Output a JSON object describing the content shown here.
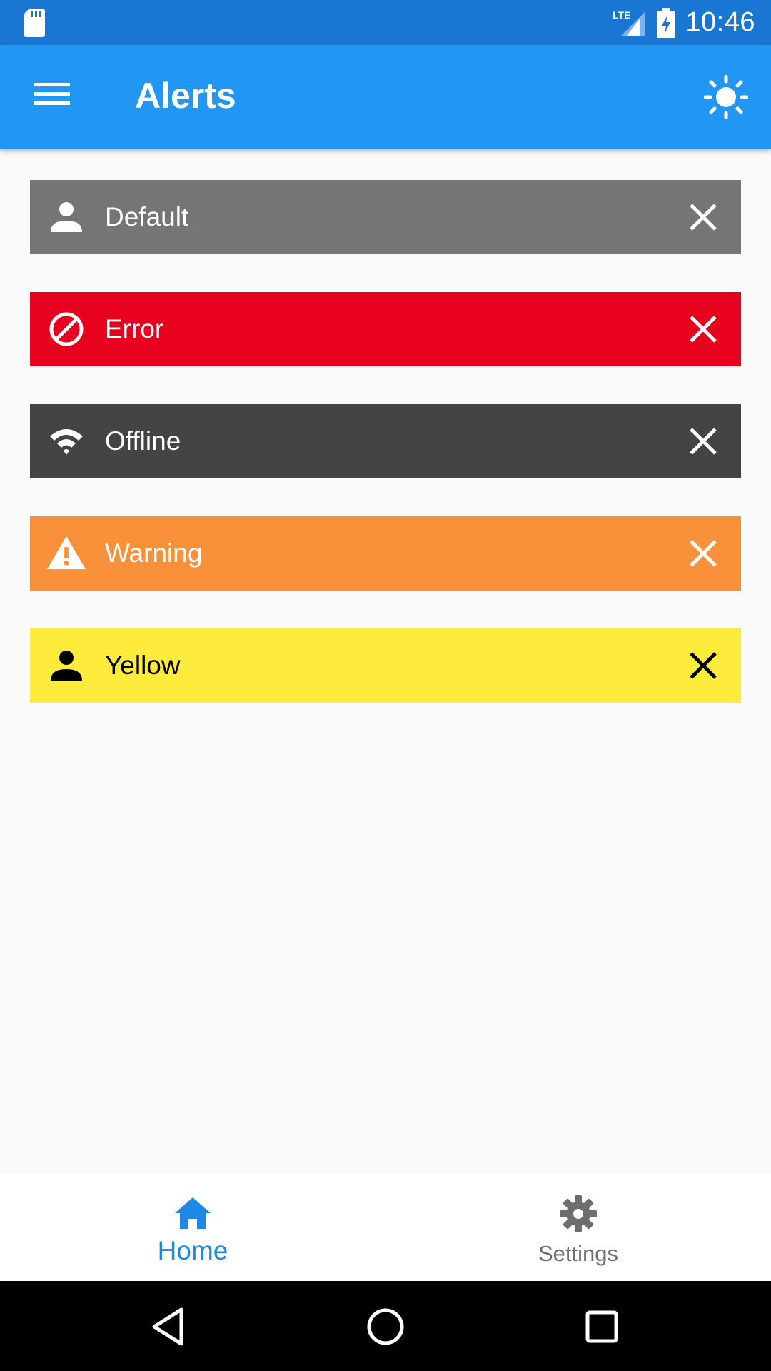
{
  "status_bar": {
    "time": "10:46",
    "network": "LTE",
    "icons": [
      "sd-card-icon",
      "signal-icon",
      "battery-charging-icon"
    ]
  },
  "app_bar": {
    "title": "Alerts",
    "menu_icon": "menu-icon",
    "theme_icon": "sun-icon",
    "background": "#2196f3"
  },
  "alerts": [
    {
      "label": "Default",
      "icon": "person-icon",
      "background": "#757575",
      "text_color": "#ffffff"
    },
    {
      "label": "Error",
      "icon": "block-icon",
      "background": "#e8001f",
      "text_color": "#ffffff"
    },
    {
      "label": "Offline",
      "icon": "wifi-icon",
      "background": "#444444",
      "text_color": "#ffffff"
    },
    {
      "label": "Warning",
      "icon": "warning-icon",
      "background": "#f8913a",
      "text_color": "#ffffff"
    },
    {
      "label": "Yellow",
      "icon": "person-icon",
      "background": "#ffeb3b",
      "text_color": "#000000"
    }
  ],
  "bottom_nav": {
    "items": [
      {
        "label": "Home",
        "icon": "home-icon",
        "active": true,
        "color": "#1e88e5"
      },
      {
        "label": "Settings",
        "icon": "gear-icon",
        "active": false,
        "color": "#6e6e6e"
      }
    ]
  },
  "system_nav": {
    "buttons": [
      "back-icon",
      "home-circle-icon",
      "recents-icon"
    ]
  }
}
